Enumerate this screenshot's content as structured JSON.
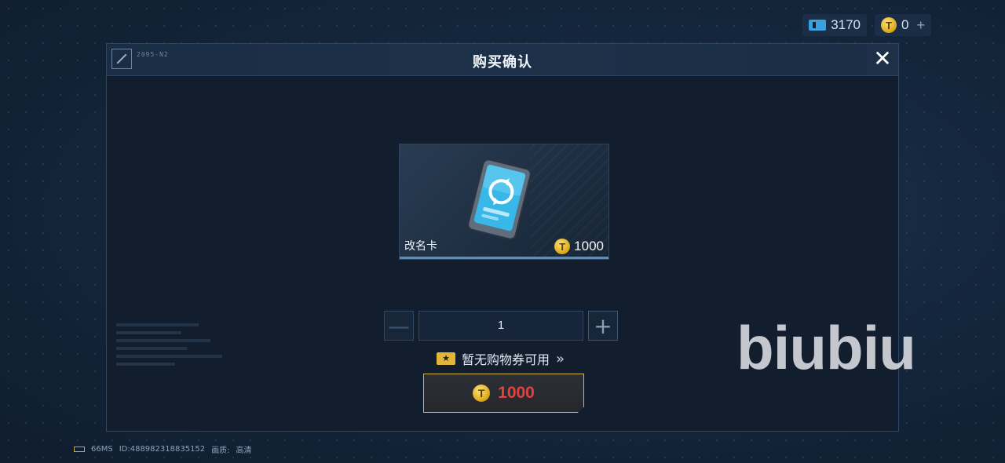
{
  "currency": {
    "tickets": "3170",
    "coins": "0",
    "coin_glyph": "T",
    "add_glyph": "+"
  },
  "dialog": {
    "title": "购买确认",
    "close_glyph": "✕",
    "header_code": "2095-N2"
  },
  "item": {
    "name": "改名卡",
    "price": "1000",
    "icon": "rename-card-icon"
  },
  "quantity": {
    "value": "1",
    "minus_glyph": "—",
    "plus_glyph": "+"
  },
  "coupon": {
    "text": "暂无购物券可用",
    "arrow_glyph": "»"
  },
  "buy": {
    "price": "1000"
  },
  "watermark": "biubiu",
  "status": {
    "ping": "66MS",
    "id": "ID:488982318835152",
    "quality_label": "画质:",
    "quality_value": "高清"
  },
  "colors": {
    "accent_gold": "#d7b548",
    "price_red": "#e3423e",
    "ticket_blue": "#3aa0e0"
  }
}
